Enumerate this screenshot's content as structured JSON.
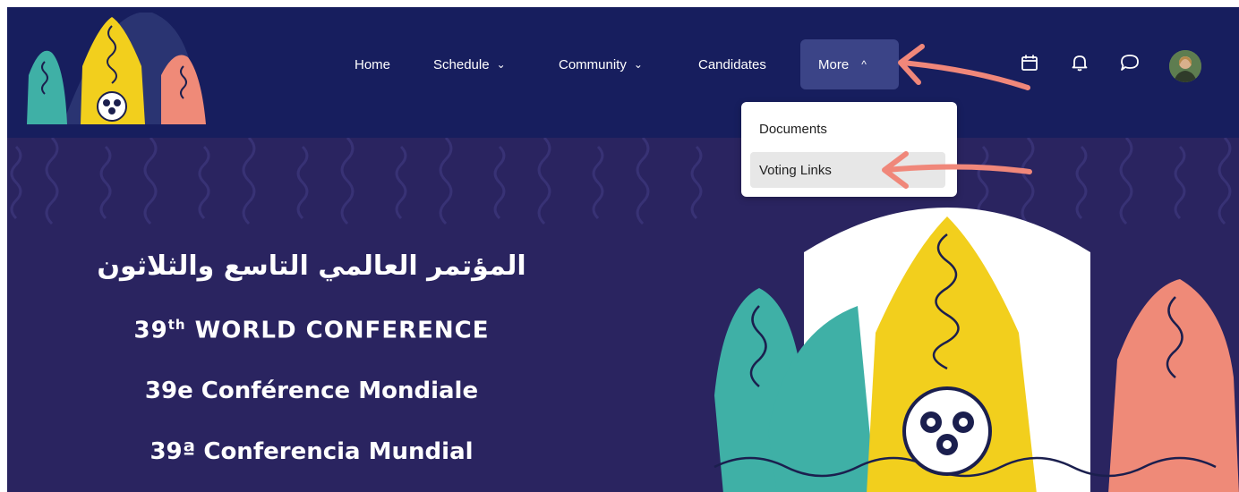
{
  "nav": {
    "items": [
      {
        "label": "Home"
      },
      {
        "label": "Schedule",
        "chevron": "⌄"
      },
      {
        "label": "Community",
        "chevron": "⌄"
      },
      {
        "label": "Candidates"
      },
      {
        "label": "More",
        "chevron": "^"
      }
    ],
    "icons": [
      "calendar-icon",
      "bell-icon",
      "chat-icon",
      "user-avatar"
    ]
  },
  "dropdown": {
    "items": [
      {
        "label": "Documents"
      },
      {
        "label": "Voting Links"
      }
    ]
  },
  "hero": {
    "arabic_title": "المؤتمر العالمي التاسع والثلاثون",
    "english_title": "39th WORLD CONFERENCE",
    "english_number": "39",
    "english_sup": "th",
    "english_rest": " WORLD CONFERENCE",
    "french_title": "39e Conférence Mondiale",
    "spanish_title": "39ª Conferencia Mundial"
  },
  "colors": {
    "navbar": "#171e5e",
    "hero_bg": "#2a2460",
    "accent_teal": "#3fb0a6",
    "accent_yellow": "#f2cf1d",
    "accent_salmon": "#ef8a78",
    "annotation_arrow": "#f0877a",
    "more_button_bg": "#3b4487"
  }
}
